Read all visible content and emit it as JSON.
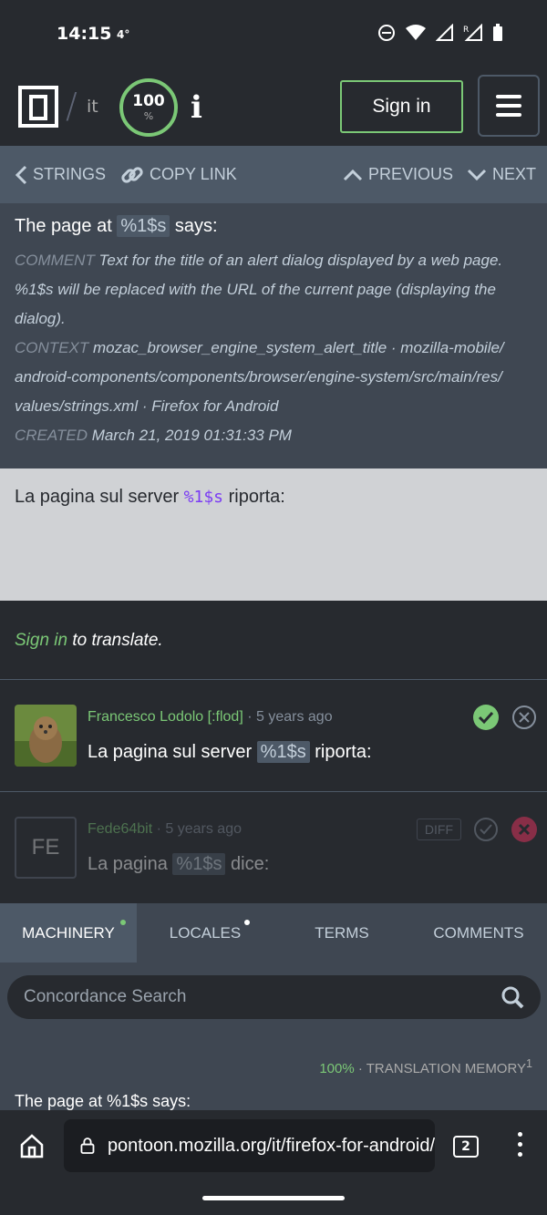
{
  "status_bar": {
    "time": "14:15",
    "temperature": "4°"
  },
  "header": {
    "locale": "it",
    "progress": {
      "value": "100",
      "unit": "%"
    },
    "info_icon": "i",
    "sign_in": "Sign in"
  },
  "navbar": {
    "strings": "STRINGS",
    "copy_link": "COPY LINK",
    "previous": "PREVIOUS",
    "next": "NEXT"
  },
  "source": {
    "title_before": "The page at ",
    "placeholder": "%1$s",
    "title_after": " says:",
    "comment_label": "COMMENT",
    "comment_text": " Text for the title of an alert dialog displayed by a web page. %1$s will be replaced with the URL of the current page (displaying the dialog).",
    "context_label": "CONTEXT",
    "context_text": " mozac_browser_engine_system_alert_title · mozilla-mobile/ android-components/components/browser/engine-system/src/main/res/ values/strings.xml · Firefox for Android",
    "created_label": "CREATED",
    "created_text": " March 21, 2019 01:31:33 PM"
  },
  "editor": {
    "before": "La pagina sul server ",
    "placeholder": "%1$s",
    "after": " riporta:"
  },
  "signin_note": {
    "link": "Sign in",
    "text": " to translate."
  },
  "history": [
    {
      "user": "Francesco Lodolo [:flod]",
      "age": " · 5 years ago",
      "before": "La pagina sul server ",
      "placeholder": "%1$s",
      "after": " riporta:"
    },
    {
      "initials": "FE",
      "user": "Fede64bit",
      "age": " · 5 years ago",
      "diff": "DIFF",
      "before": "La pagina ",
      "placeholder": "%1$s",
      "after": " dice:"
    }
  ],
  "tabs": [
    {
      "label": "MACHINERY",
      "dot": "#7bc876"
    },
    {
      "label": "LOCALES",
      "dot": "#ffffff"
    },
    {
      "label": "TERMS"
    },
    {
      "label": "COMMENTS"
    }
  ],
  "machinery": {
    "search_placeholder": "Concordance Search",
    "quality": "100%",
    "source_label": " · TRANSLATION MEMORY",
    "count": "1",
    "first_source": "The page at %1$s says:"
  },
  "browser": {
    "url": "pontoon.mozilla.org/it/firefox-for-android/",
    "tab_count": "2"
  },
  "colors": {
    "accent_green": "#7bc876",
    "placeholder_purple": "#7b3cf4",
    "reject_red": "#f36"
  }
}
